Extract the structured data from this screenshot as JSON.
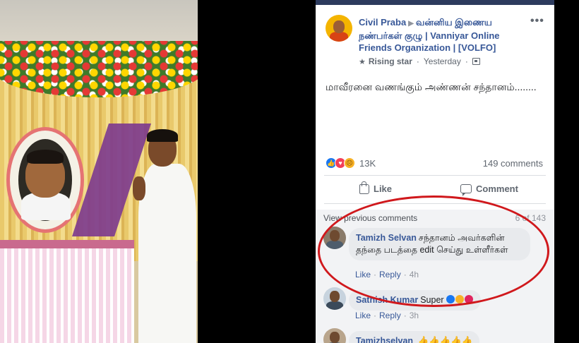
{
  "post": {
    "author": "Civil Praba",
    "group": "வன்னிய இணைய நண்பர்கள் குழு | Vanniyar Online Friends Organization | [VOLFO]",
    "badge": "Rising star",
    "time": "Yesterday",
    "text": "மாவீரனை வணங்கும் அண்ணன் சந்தானம்........",
    "reaction_count": "13K",
    "comments_count": "149 comments",
    "more_label": "•••"
  },
  "actions": {
    "like": "Like",
    "comment": "Comment"
  },
  "comments_section": {
    "view_previous": "View previous comments",
    "pager": "6 of 143"
  },
  "comments": [
    {
      "name": "Tamizh Selvan",
      "text": "சந்தானம் அவர்களின் தந்தை படத்தை edit செய்து உள்ளீர்கள்",
      "like": "Like",
      "reply": "Reply",
      "time": "4h"
    },
    {
      "name": "Sathish Kumar",
      "text": "Super",
      "like": "Like",
      "reply": "Reply",
      "time": "3h"
    },
    {
      "name": "Tamizhselvan",
      "text": ""
    }
  ],
  "colors": {
    "link": "#385898",
    "annotation": "#d0181c",
    "like_reaction": "#1877f2",
    "love_reaction": "#f33e58"
  }
}
